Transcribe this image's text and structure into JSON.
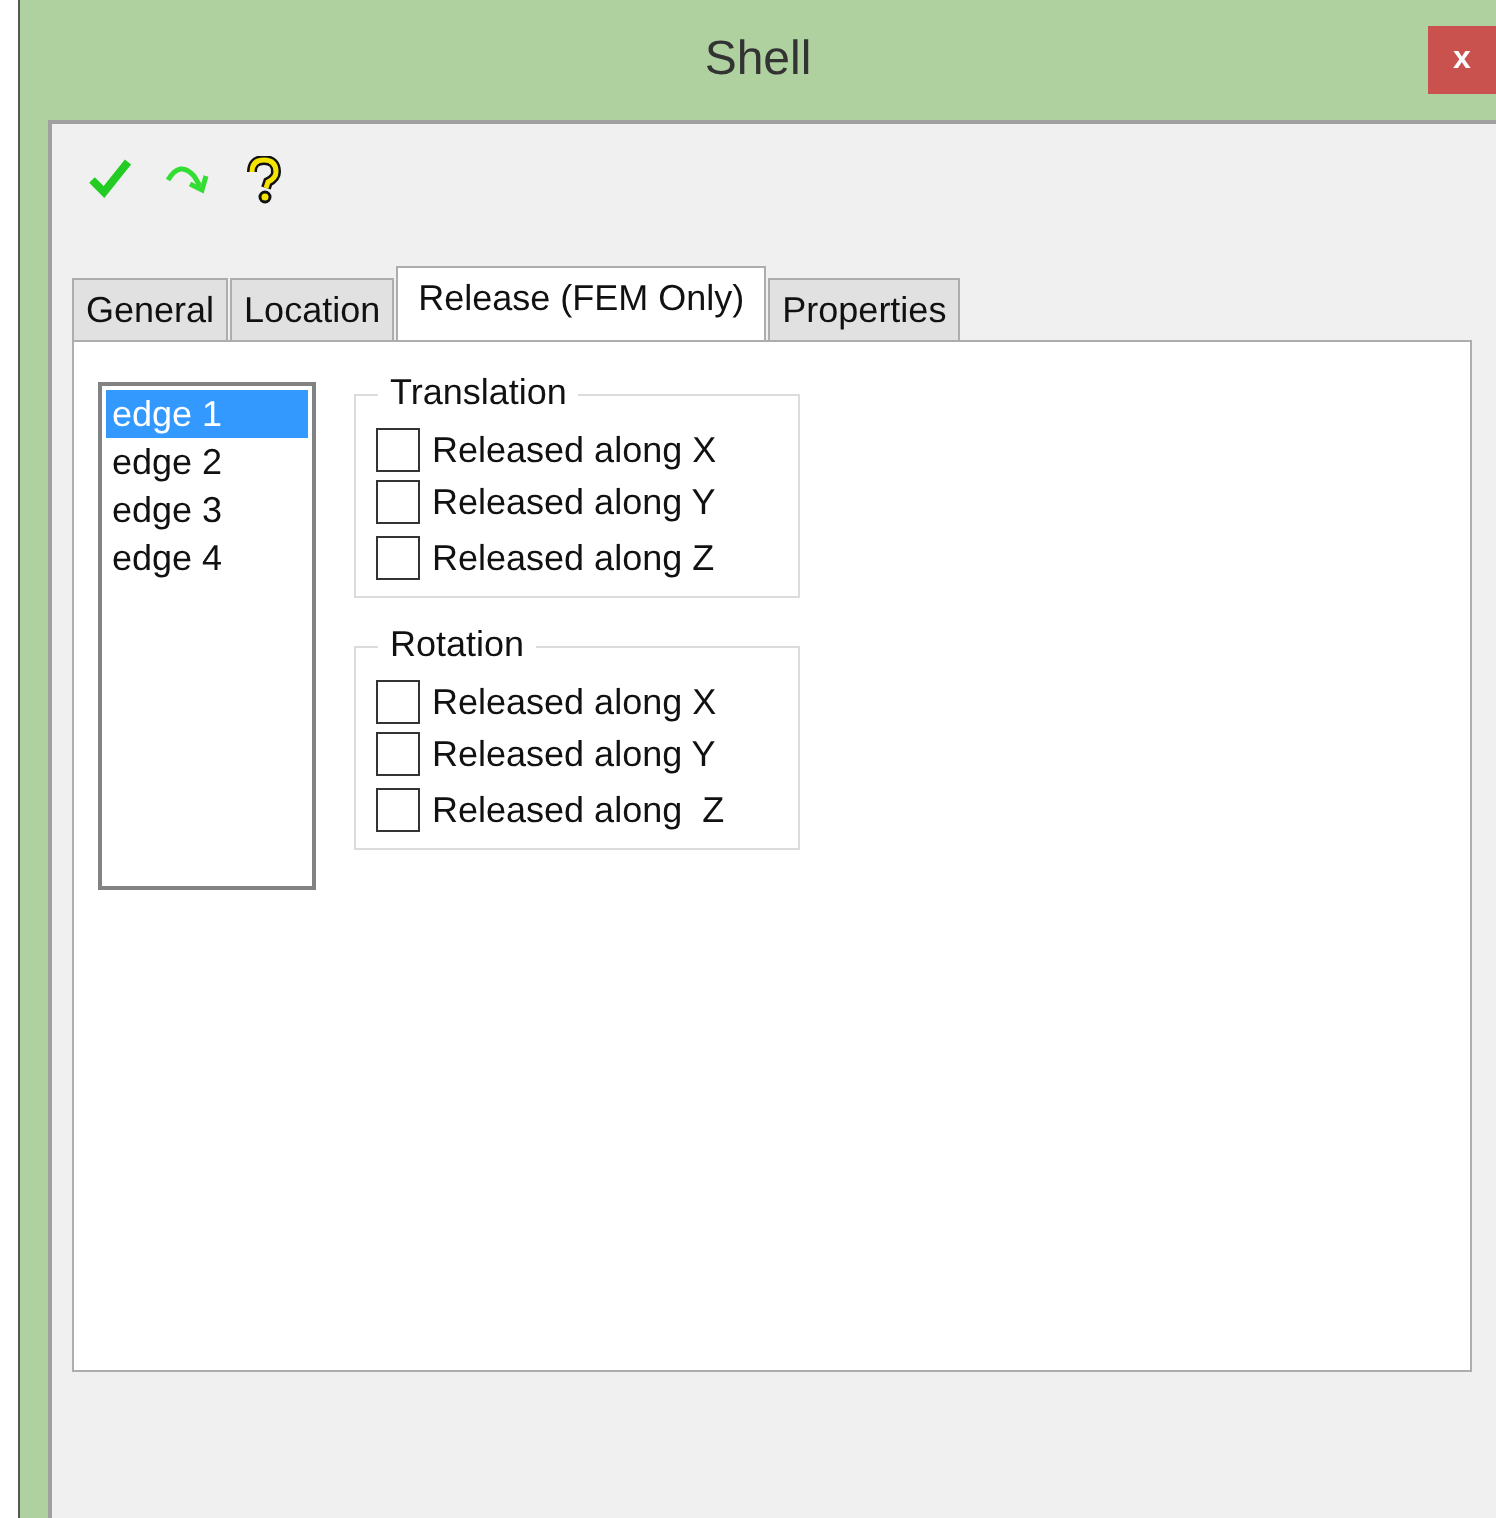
{
  "window": {
    "title": "Shell",
    "close": "x"
  },
  "toolbar": [
    {
      "kind": "check"
    },
    {
      "kind": "redo"
    },
    {
      "kind": "help"
    }
  ],
  "tabs": [
    {
      "label": "General",
      "selected": false
    },
    {
      "label": "Location",
      "selected": false
    },
    {
      "label": "Release (FEM Only)",
      "selected": true
    },
    {
      "label": "Properties",
      "selected": false
    }
  ],
  "edges": [
    {
      "label": "edge 1",
      "selected": true
    },
    {
      "label": "edge 2",
      "selected": false
    },
    {
      "label": "edge 3",
      "selected": false
    },
    {
      "label": "edge 4",
      "selected": false
    }
  ],
  "groups": [
    {
      "title": "Translation",
      "options": [
        {
          "label": "Released along X",
          "checked": false
        },
        {
          "label": "Released along Y",
          "checked": false
        },
        {
          "label": "Released along Z",
          "checked": false
        }
      ]
    },
    {
      "title": "Rotation",
      "options": [
        {
          "label": "Released along X",
          "checked": false
        },
        {
          "label": "Released along Y",
          "checked": false
        },
        {
          "label": "Released along  Z",
          "checked": false
        }
      ]
    }
  ]
}
